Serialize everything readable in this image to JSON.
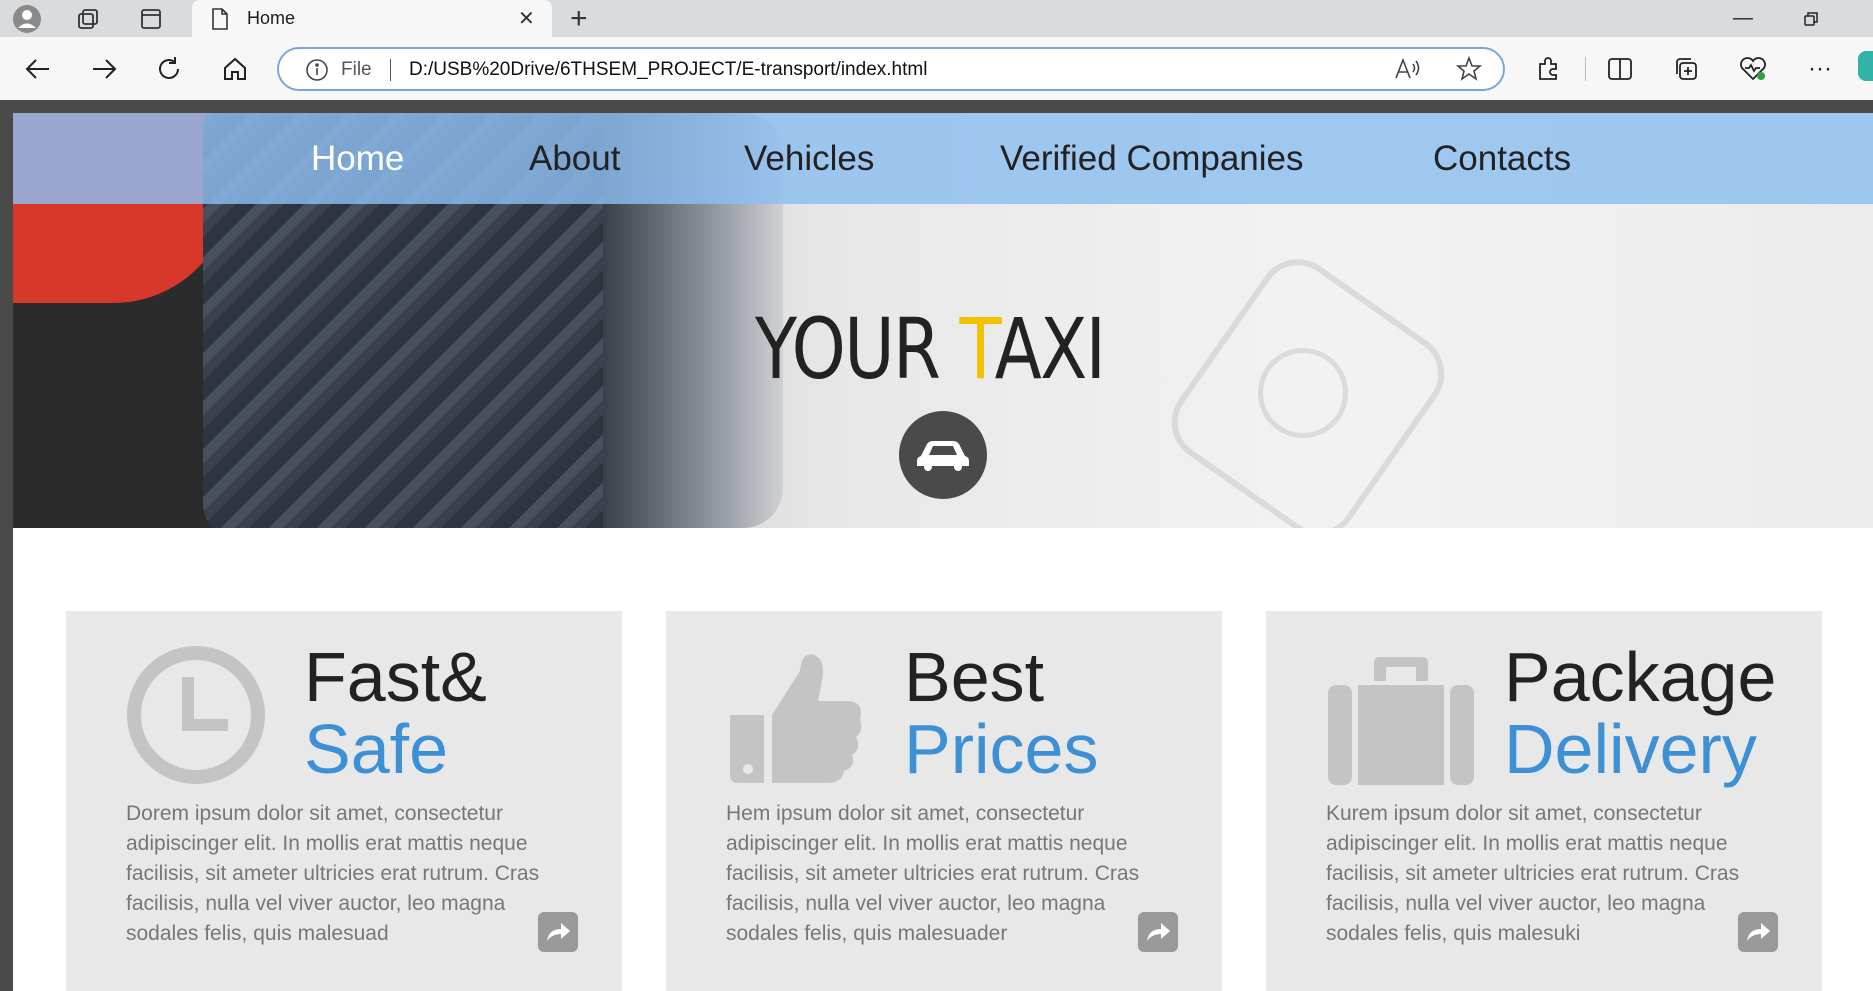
{
  "browser": {
    "tab_title": "Home",
    "address_prefix": "File",
    "url": "D:/USB%20Drive/6THSEM_PROJECT/E-transport/index.html"
  },
  "nav": {
    "items": [
      "Home",
      "About",
      "Vehicles",
      "Verified Companies",
      "Contacts"
    ],
    "active": "Home"
  },
  "hero": {
    "brand_part1": "YOUR ",
    "brand_accent": "T",
    "brand_part2": "AXI"
  },
  "cards": [
    {
      "title1": "Fast&",
      "title2": "Safe",
      "icon": "clock-icon",
      "text": "Dorem ipsum dolor sit amet, consectetur adipiscinger elit. In mollis erat mattis neque facilisis, sit ameter ultricies erat rutrum. Cras facilisis, nulla vel viver auctor, leo magna sodales felis, quis malesuad"
    },
    {
      "title1": "Best",
      "title2": "Prices",
      "icon": "thumbs-up-icon",
      "text": "Hem ipsum dolor sit amet, consectetur adipiscinger elit. In mollis erat mattis neque facilisis, sit ameter ultricies erat rutrum. Cras facilisis, nulla vel viver auctor, leo magna sodales felis, quis malesuader"
    },
    {
      "title1": "Package",
      "title2": "Delivery",
      "icon": "briefcase-icon",
      "text": "Kurem ipsum dolor sit amet, consectetur adipiscinger elit. In mollis erat mattis neque facilisis, sit ameter ultricies erat rutrum. Cras facilisis, nulla vel viver auctor, leo magna sodales felis, quis malesuki"
    }
  ],
  "colors": {
    "nav_bg": "#8cbef0",
    "accent_blue": "#3d8fd6",
    "accent_yellow": "#f2c200",
    "card_bg": "#e8e8e8"
  }
}
